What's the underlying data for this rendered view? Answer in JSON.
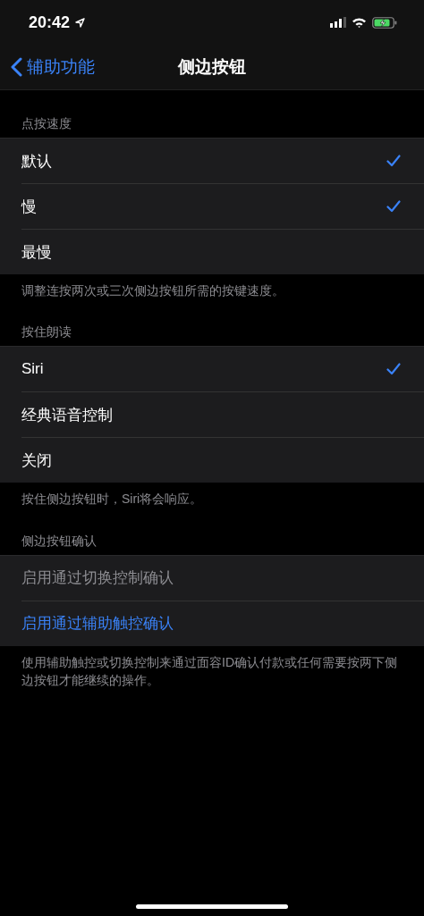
{
  "status_bar": {
    "time": "20:42"
  },
  "nav": {
    "back": "辅助功能",
    "title": "侧边按钮"
  },
  "sections": [
    {
      "header": "点按速度",
      "kind": "choice",
      "items": [
        {
          "label": "默认",
          "selected": true
        },
        {
          "label": "慢",
          "selected": true
        },
        {
          "label": "最慢",
          "selected": false
        }
      ],
      "footer": "调整连按两次或三次侧边按钮所需的按键速度。"
    },
    {
      "header": "按住朗读",
      "kind": "choice",
      "items": [
        {
          "label": "Siri",
          "selected": true
        },
        {
          "label": "经典语音控制",
          "selected": false
        },
        {
          "label": "关闭",
          "selected": false
        }
      ],
      "footer": "按住侧边按钮时，Siri将会响应。"
    },
    {
      "header": "侧边按钮确认",
      "kind": "action",
      "items": [
        {
          "label": "启用通过切换控制确认",
          "disabled": true
        },
        {
          "label": "启用通过辅助触控确认",
          "disabled": false
        }
      ],
      "footer": "使用辅助触控或切换控制来通过面容ID确认付款或任何需要按两下侧边按钮才能继续的操作。"
    }
  ]
}
